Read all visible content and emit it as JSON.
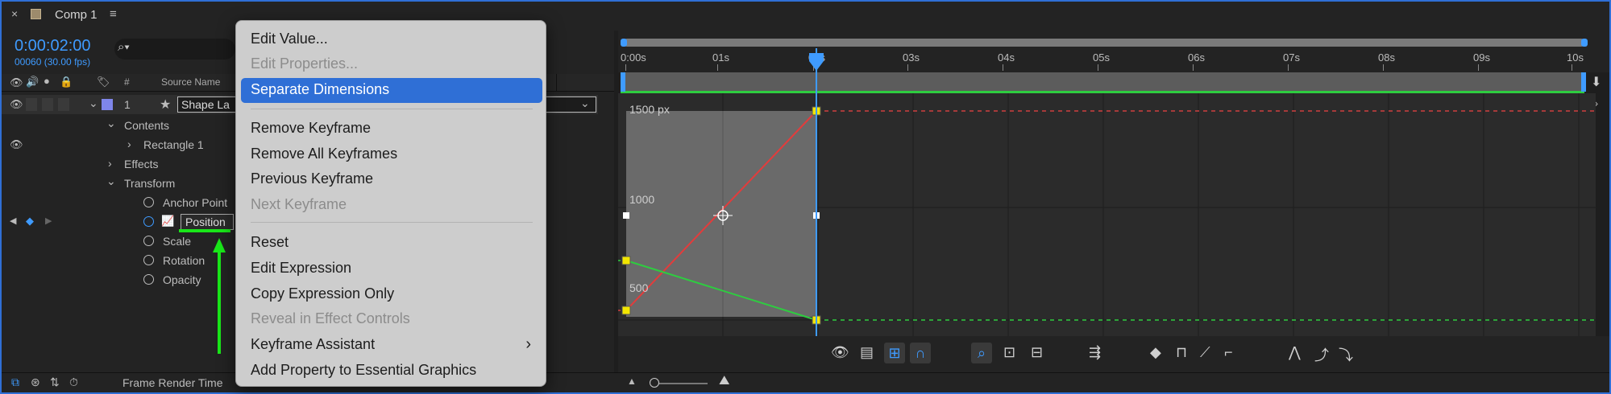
{
  "tab": {
    "title": "Comp 1",
    "close": "×",
    "menu": "≡"
  },
  "timecode": "0:00:02:00",
  "fps": "00060 (30.00 fps)",
  "columns": {
    "num": "#",
    "source": "Source Name"
  },
  "layer": {
    "number": "1",
    "name": "Shape La"
  },
  "tree": {
    "contents": "Contents",
    "rectangle": "Rectangle 1",
    "effects": "Effects",
    "transform": "Transform",
    "anchor": "Anchor Point",
    "position": "Position",
    "scale": "Scale",
    "rotation": "Rotation",
    "opacity": "Opacity"
  },
  "status": {
    "frame_render": "Frame Render Time"
  },
  "ruler_labels": [
    "0:00s",
    "01s",
    "02s",
    "03s",
    "04s",
    "05s",
    "06s",
    "07s",
    "08s",
    "09s",
    "10s"
  ],
  "graph_labels": {
    "top": "1500 px",
    "mid": "1000",
    "low": "500"
  },
  "context_menu": {
    "items": [
      {
        "label": "Edit Value...",
        "disabled": false
      },
      {
        "label": "Edit Properties...",
        "disabled": true
      },
      {
        "label": "Separate Dimensions",
        "disabled": false,
        "highlighted": true
      },
      {
        "label": "Remove Keyframe",
        "disabled": false
      },
      {
        "label": "Remove All Keyframes",
        "disabled": false
      },
      {
        "label": "Previous Keyframe",
        "disabled": false
      },
      {
        "label": "Next Keyframe",
        "disabled": true
      },
      {
        "label": "Reset",
        "disabled": false
      },
      {
        "label": "Edit Expression",
        "disabled": false
      },
      {
        "label": "Copy Expression Only",
        "disabled": false
      },
      {
        "label": "Reveal in Effect Controls",
        "disabled": true
      },
      {
        "label": "Keyframe Assistant",
        "disabled": false,
        "submenu": true
      },
      {
        "label": "Add Property to Essential Graphics",
        "disabled": false
      }
    ],
    "submenu_arrow": "›"
  },
  "colors": {
    "accent": "#2f6fd6",
    "timecode": "#3f9bff",
    "curve_red": "#e23c3c",
    "curve_green": "#2ecc40",
    "keyframe": "#f2e600",
    "annotation": "#19e619"
  }
}
